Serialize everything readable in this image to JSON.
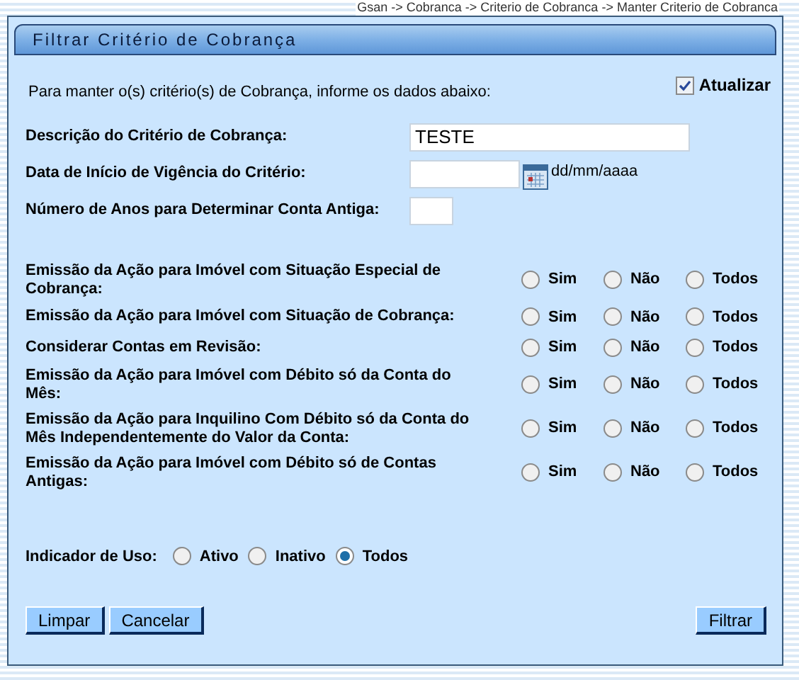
{
  "breadcrumb": "Gsan -> Cobranca -> Criterio de Cobranca -> Manter Criterio de Cobranca",
  "title": "Filtrar Critério de Cobrança",
  "intro": "Para manter o(s) critério(s) de Cobrança, informe os dados abaixo:",
  "update_option": {
    "label": "Atualizar",
    "checked": true
  },
  "fields": [
    {
      "kind": "text",
      "label": "Descrição do Critério de Cobrança:",
      "value": "TESTE"
    },
    {
      "kind": "date",
      "label": "Data de Início de Vigência do Critério:",
      "hint": "dd/mm/aaaa"
    },
    {
      "kind": "short",
      "label": "Número de Anos para Determinar Conta Antiga:"
    }
  ],
  "choices": [
    {
      "label": "Emissão da Ação para Imóvel com Situação Especial de Cobrança:",
      "options": [
        {
          "label": "Sim",
          "selected": false
        },
        {
          "label": "Não",
          "selected": false
        },
        {
          "label": "Todos",
          "selected": false
        }
      ]
    },
    {
      "label": "Emissão da Ação para Imóvel com Situação de Cobrança:",
      "options": [
        {
          "label": "Sim",
          "selected": false
        },
        {
          "label": "Não",
          "selected": false
        },
        {
          "label": "Todos",
          "selected": false
        }
      ]
    },
    {
      "label": "Considerar Contas em Revisão:",
      "options": [
        {
          "label": "Sim",
          "selected": false
        },
        {
          "label": "Não",
          "selected": false
        },
        {
          "label": "Todos",
          "selected": false
        }
      ]
    },
    {
      "label": "Emissão da Ação para Imóvel com Débito só da Conta do Mês:",
      "options": [
        {
          "label": "Sim",
          "selected": false
        },
        {
          "label": "Não",
          "selected": false
        },
        {
          "label": "Todos",
          "selected": false
        }
      ]
    },
    {
      "label": "Emissão da Ação para Inquilino Com Débito só da Conta do Mês Independentemente do Valor da Conta:",
      "options": [
        {
          "label": "Sim",
          "selected": false
        },
        {
          "label": "Não",
          "selected": false
        },
        {
          "label": "Todos",
          "selected": false
        }
      ]
    },
    {
      "label": "Emissão da Ação para Imóvel com Débito só de Contas Antigas:",
      "options": [
        {
          "label": "Sim",
          "selected": false
        },
        {
          "label": "Não",
          "selected": false
        },
        {
          "label": "Todos",
          "selected": false
        }
      ]
    }
  ],
  "usage": {
    "label": "Indicador de Uso:",
    "options": [
      {
        "label": "Ativo",
        "selected": false
      },
      {
        "label": "Inativo",
        "selected": false
      },
      {
        "label": "Todos",
        "selected": true
      }
    ]
  },
  "buttons_left": [
    "Limpar",
    "Cancelar"
  ],
  "buttons_right": [
    "Filtrar"
  ]
}
